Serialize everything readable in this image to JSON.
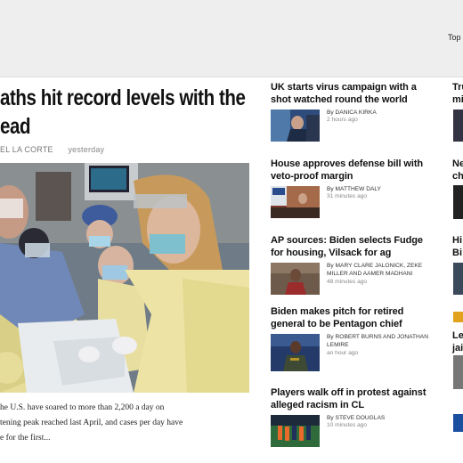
{
  "topbar": {
    "link_label": "Top S"
  },
  "main": {
    "headline_line1": "aths hit record levels with the",
    "headline_line2": "ead",
    "author": "EL LA CORTE",
    "time": "yesterday",
    "summary": "he U.S. have soared to more than 2,200 a day on\ntening peak reached last April, and cases per day have\ne for the first..."
  },
  "stories": [
    {
      "title": "UK starts virus campaign with a shot watched round the world",
      "by": "By",
      "author": "DANICA KIRKA",
      "time": "2 hours ago"
    },
    {
      "title": "House approves defense bill with veto-proof margin",
      "by": "By",
      "author": "MATTHEW DALY",
      "time": "31 minutes ago"
    },
    {
      "title": "AP sources: Biden selects Fudge for housing, Vilsack for ag",
      "by": "By",
      "author": "MARY CLARE JALONICK, ZEKE MILLER and AAMER MADHANI",
      "time": "48 minutes ago"
    },
    {
      "title": "Biden makes pitch for retired general to be Pentagon chief",
      "by": "By",
      "author": "ROBERT BURNS and JONATHAN LEMIRE",
      "time": "an hour ago"
    },
    {
      "title": "Players walk off in protest against alleged racism in CL",
      "by": "By",
      "author": "STEVE DOUGLAS",
      "time": "10 minutes ago"
    }
  ],
  "right": [
    {
      "line1": "Tru",
      "line2": "mi"
    },
    {
      "line1": "Ne",
      "line2": "ch"
    },
    {
      "line1": "Hi",
      "line2": "Bi"
    },
    {
      "line1": "Le",
      "line2": "jai"
    }
  ],
  "colors": {
    "accent_gold": "#e2a21d",
    "link_blue": "#1a4fa0"
  }
}
